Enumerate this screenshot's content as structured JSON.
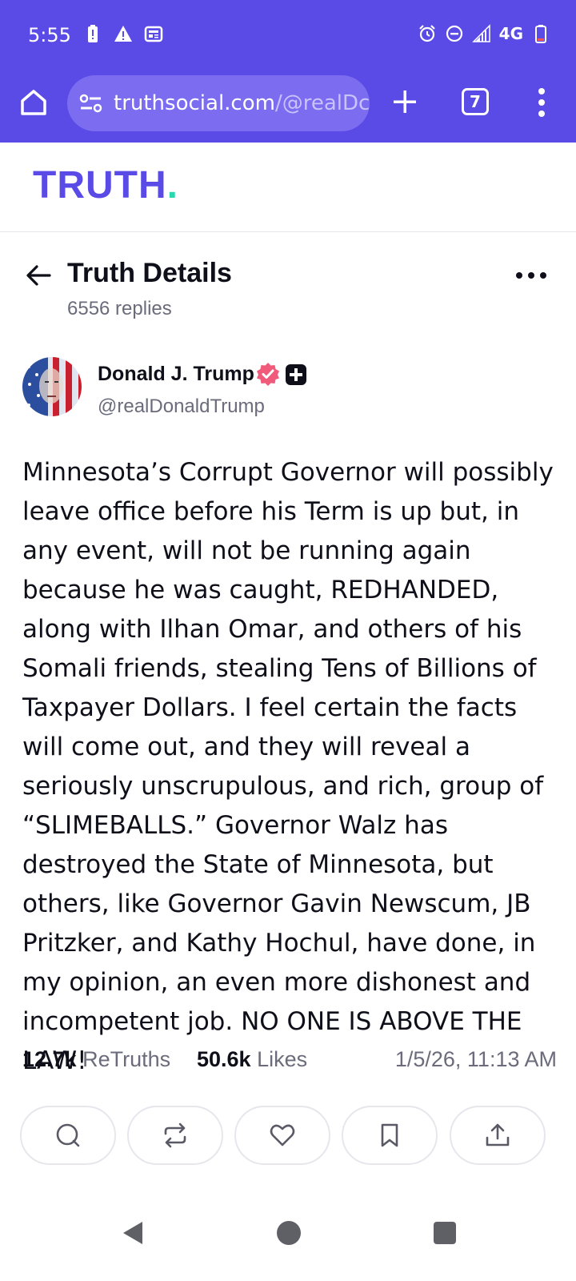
{
  "status_bar": {
    "time": "5:55",
    "network": "4G"
  },
  "browser": {
    "url_host": "truthsocial.com",
    "url_path": "/@realDc",
    "tab_count": "7"
  },
  "site": {
    "logo_text": "TRUTH",
    "logo_dot": ".",
    "brand_color": "#5b4be6",
    "accent_color": "#27d8b1"
  },
  "page": {
    "title": "Truth Details",
    "replies": "6556 replies"
  },
  "post": {
    "author_name": "Donald J. Trump",
    "author_handle": "@realDonaldTrump",
    "body": "Minnesota’s Corrupt Governor will possibly leave office before his Term is up but, in any event, will not be running again because he was caught, REDHANDED, along with Ilhan Omar, and others of his Somali friends, stealing Tens of Billions of Taxpayer Dollars. I feel certain the facts will come out, and they will reveal a seriously unscrupulous, and rich, group of “SLIMEBALLS.” Governor Walz has destroyed the State of Minnesota, but others, like Governor Gavin Newscum, JB Pritzker, and Kathy Hochul, have done, in my opinion, an even more dishonest and incompetent job. NO ONE IS ABOVE THE LAW!",
    "retruths_count": "12.7k",
    "retruths_label": "ReTruths",
    "likes_count": "50.6k",
    "likes_label": "Likes",
    "timestamp": "1/5/26, 11:13 AM"
  },
  "actions": [
    "reply-icon",
    "retruth-icon",
    "like-icon",
    "bookmark-icon",
    "share-icon"
  ]
}
